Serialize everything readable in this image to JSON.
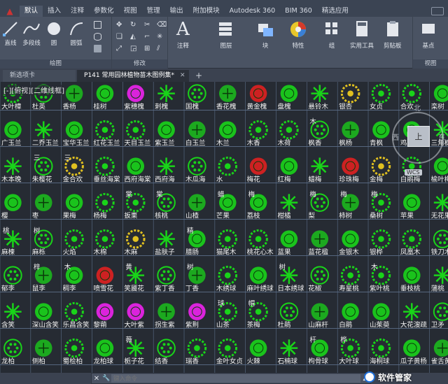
{
  "app_button_icon": "autocad-a-icon",
  "ribbon_tabs": [
    "默认",
    "插入",
    "注释",
    "参数化",
    "视图",
    "管理",
    "输出",
    "附加模块",
    "Autodesk 360",
    "BIM 360",
    "精选应用"
  ],
  "active_tab": "默认",
  "panels": {
    "draw": {
      "title": "绘图",
      "tools": [
        "直线",
        "多段线",
        "圆",
        "圆弧"
      ]
    },
    "modify": {
      "title": "修改"
    },
    "annotation": {
      "label": "注释"
    },
    "layer": {
      "label": "图层"
    },
    "block": {
      "label": "块"
    },
    "properties": {
      "label": "特性"
    },
    "group": {
      "label": "组"
    },
    "utilities": {
      "label": "实用工具"
    },
    "clipboard": {
      "label": "剪贴板"
    },
    "base": {
      "label": "基点"
    },
    "view": {
      "title": "视图"
    }
  },
  "doc_tabs": [
    {
      "label": "新选项卡"
    },
    {
      "label": "P141 常用园林植物苗木图例集*"
    }
  ],
  "view_label": "[-][俯视][二维线框]",
  "viewcube": {
    "north": "北",
    "west": "西",
    "east": "东",
    "face": "上",
    "wcs": "WCS"
  },
  "plant_rows": [
    [
      "大叶樟",
      "杜英",
      "香杨",
      "桂树",
      "紫穗槐",
      "刺槐",
      "国槐",
      "香花槐",
      "黄金槐",
      "盘槐",
      "悬铃木",
      "银杏",
      "女贞",
      "合欢",
      "栾树"
    ],
    [
      "广玉兰",
      "二乔玉兰",
      "宝华玉兰",
      "红花玉兰",
      "天目玉兰",
      "紫玉兰",
      "白玉兰",
      "木兰",
      "木香",
      "木荷",
      "枫香",
      "枫杨",
      "青枫",
      "鸡爪槭",
      "三角枫"
    ],
    [
      "木本晚",
      "朱樱花",
      "金合欢",
      "垂丝海棠",
      "西府海棠",
      "西府海",
      "木瓜海",
      "水",
      "梅花",
      "红梅",
      "蜡梅",
      "珍珠梅",
      "金梅",
      "白鹃梅",
      "榆叶梅"
    ],
    [
      "樱",
      "枣",
      "果梅",
      "杨梅",
      "扳栗",
      "核桃",
      "山楂",
      "芒果",
      "荔枝",
      "柑橘",
      "梨",
      "柿树",
      "桑树",
      "苹果",
      "无花果"
    ],
    [
      "麻楝",
      "麻栎",
      "火焰",
      "木棉",
      "木麻",
      "盐肤子",
      "腊肠",
      "猫尾木",
      "桃花心木",
      "蓝果",
      "蓝花楹",
      "金银木",
      "银桦",
      "凤凰木",
      "铁刀木"
    ],
    [
      "郁李",
      "鼠李",
      "稠李",
      "喷雪花",
      "笑靥花",
      "紫丁香",
      "丁香",
      "木绣球",
      "麻叶绣球",
      "日本绣球",
      "花椒",
      "寿星桃",
      "紫叶桃",
      "垂枝桃",
      "蒲桃"
    ],
    [
      "含笑",
      "深山含笑",
      "乐昌含笑",
      "黎蒴",
      "大叶紫",
      "拐生紫",
      "紫荆",
      "山茶",
      "茶梅",
      "杜鹃",
      "山麻杆",
      "白鹃",
      "山茱萸",
      "大花溲疏",
      "卫矛"
    ],
    [
      "龙柏",
      "侧柏",
      "蜀桧柏",
      "龙柏球",
      "栀子花",
      "结香",
      "瑞香",
      "金叶女贞",
      "火棘",
      "石楠球",
      "枸骨球",
      "大叶球",
      "海桐球",
      "瓜子黄杨",
      "雀舌黄杨"
    ]
  ],
  "overlay_labels": [
    "木",
    "三",
    "三",
    "棠",
    "棠",
    "蜡",
    "梅",
    "梅",
    "梅",
    "梅",
    "桃",
    "树",
    "精",
    "梓",
    "木",
    "黄",
    "树",
    "树",
    "木",
    "球",
    "帽",
    "杆",
    "薇",
    "桦"
  ],
  "command_line": {
    "close_icon": "close-icon",
    "placeholder": "键入命令"
  },
  "watermark": {
    "text": "软件管家"
  },
  "colors": {
    "ribbon": "#4a5363",
    "canvas": "#262b33",
    "grid": "#5c6f8a",
    "green": "#19d419",
    "red": "#e02020",
    "yellow": "#e0c020",
    "magenta": "#ee22ee"
  }
}
